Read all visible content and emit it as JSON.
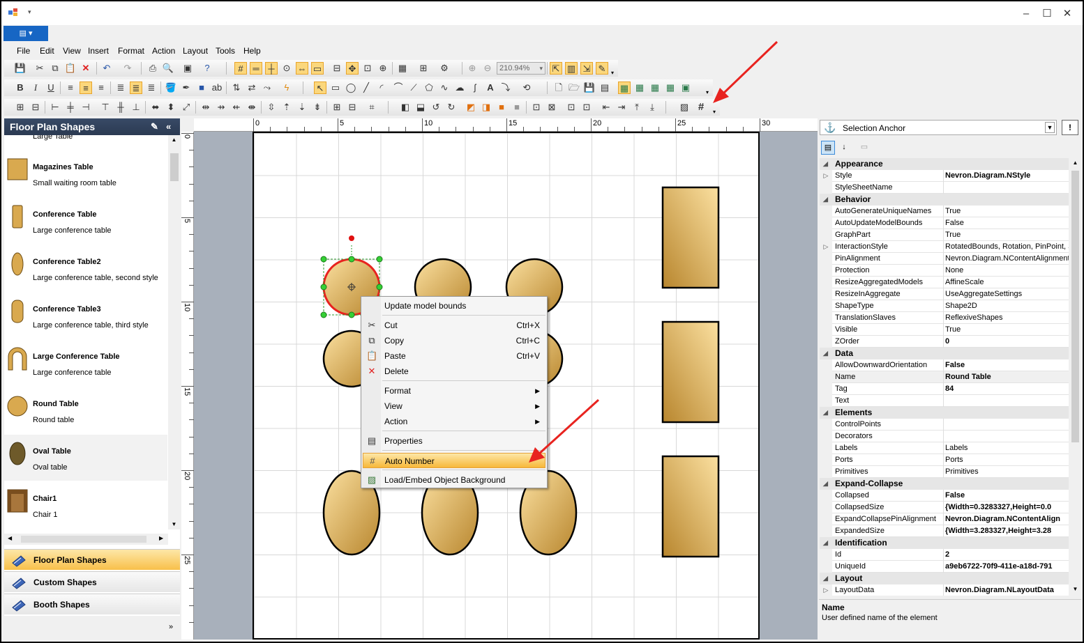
{
  "window": {
    "minimize": "–",
    "maximize": "☐",
    "close": "✕"
  },
  "menu": [
    "File",
    "Edit",
    "View",
    "Insert",
    "Format",
    "Action",
    "Layout",
    "Tools",
    "Help"
  ],
  "toolbar": {
    "zoom": "210.94%"
  },
  "left_panel": {
    "title": "Floor Plan Shapes",
    "partial_item": "Large Table",
    "shapes": [
      {
        "name": "Magazines Table",
        "desc": "Small waiting room table",
        "icon": "square"
      },
      {
        "name": "Conference Table",
        "desc": "Large conference table",
        "icon": "tallrect"
      },
      {
        "name": "Conference Table2",
        "desc": "Large conference table, second style",
        "icon": "tallellipse"
      },
      {
        "name": "Conference Table3",
        "desc": "Large conference table, third style",
        "icon": "capsule"
      },
      {
        "name": "Large Conference Table",
        "desc": "Large conference table",
        "icon": "arch"
      },
      {
        "name": "Round Table",
        "desc": "Round table",
        "icon": "circle"
      },
      {
        "name": "Oval Table",
        "desc": "Oval table",
        "icon": "oval"
      },
      {
        "name": "Chair1",
        "desc": "Chair 1",
        "icon": "chair"
      }
    ],
    "categories": [
      "Floor Plan Shapes",
      "Custom Shapes",
      "Booth Shapes"
    ]
  },
  "ruler": {
    "h": [
      "0",
      "5",
      "10",
      "15",
      "20",
      "25",
      "30"
    ],
    "v": [
      "0",
      "5",
      "10",
      "15",
      "20",
      "25"
    ]
  },
  "context_menu": {
    "items": [
      {
        "label": "Update model bounds",
        "shortcut": "",
        "icon": ""
      },
      {
        "label": "Cut",
        "shortcut": "Ctrl+X",
        "icon": "✂"
      },
      {
        "label": "Copy",
        "shortcut": "Ctrl+C",
        "icon": "⧉"
      },
      {
        "label": "Paste",
        "shortcut": "Ctrl+V",
        "icon": "📋"
      },
      {
        "label": "Delete",
        "shortcut": "",
        "icon": "✕"
      },
      {
        "label": "Format",
        "shortcut": "▶",
        "icon": ""
      },
      {
        "label": "View",
        "shortcut": "▶",
        "icon": ""
      },
      {
        "label": "Action",
        "shortcut": "▶",
        "icon": ""
      },
      {
        "label": "Properties",
        "shortcut": "",
        "icon": "▤"
      },
      {
        "label": "Auto Number",
        "shortcut": "",
        "icon": "#"
      },
      {
        "label": "Load/Embed Object Background",
        "shortcut": "",
        "icon": "▨"
      }
    ]
  },
  "property_grid": {
    "selector": "Selection Anchor",
    "rows": [
      {
        "cat": "Appearance"
      },
      {
        "n": "Style",
        "v": "Nevron.Diagram.NStyle",
        "b": true,
        "exp": true
      },
      {
        "n": "StyleSheetName",
        "v": ""
      },
      {
        "cat": "Behavior"
      },
      {
        "n": "AutoGenerateUniqueNames",
        "v": "True"
      },
      {
        "n": "AutoUpdateModelBounds",
        "v": "False"
      },
      {
        "n": "GraphPart",
        "v": "True"
      },
      {
        "n": "InteractionStyle",
        "v": "RotatedBounds, Rotation, PinPoint, S",
        "exp": true
      },
      {
        "n": "PinAlignment",
        "v": "Nevron.Diagram.NContentAlignment"
      },
      {
        "n": "Protection",
        "v": "None"
      },
      {
        "n": "ResizeAggregatedModels",
        "v": "AffineScale"
      },
      {
        "n": "ResizeInAggregate",
        "v": "UseAggregateSettings"
      },
      {
        "n": "ShapeType",
        "v": "Shape2D"
      },
      {
        "n": "TranslationSlaves",
        "v": "ReflexiveShapes"
      },
      {
        "n": "Visible",
        "v": "True"
      },
      {
        "n": "ZOrder",
        "v": "0",
        "b": true
      },
      {
        "cat": "Data"
      },
      {
        "n": "AllowDownwardOrientation",
        "v": "False",
        "b": true
      },
      {
        "n": "Name",
        "v": "Round Table",
        "b": true,
        "sel": true
      },
      {
        "n": "Tag",
        "v": "84",
        "b": true
      },
      {
        "n": "Text",
        "v": ""
      },
      {
        "cat": "Elements"
      },
      {
        "n": "ControlPoints",
        "v": ""
      },
      {
        "n": "Decorators",
        "v": ""
      },
      {
        "n": "Labels",
        "v": "Labels"
      },
      {
        "n": "Ports",
        "v": "Ports"
      },
      {
        "n": "Primitives",
        "v": "Primitives"
      },
      {
        "cat": "Expand-Collapse"
      },
      {
        "n": "Collapsed",
        "v": "False",
        "b": true
      },
      {
        "n": "CollapsedSize",
        "v": "{Width=0.3283327,Height=0.0",
        "b": true
      },
      {
        "n": "ExpandCollapsePinAlignment",
        "v": "Nevron.Diagram.NContentAlign",
        "b": true
      },
      {
        "n": "ExpandedSize",
        "v": "{Width=3.283327,Height=3.28",
        "b": true
      },
      {
        "cat": "Identification"
      },
      {
        "n": "Id",
        "v": "2",
        "b": true
      },
      {
        "n": "UniqueId",
        "v": "a9eb6722-70f9-411e-a18d-791",
        "b": true
      },
      {
        "cat": "Layout"
      },
      {
        "n": "LayoutData",
        "v": "Nevron.Diagram.NLayoutData",
        "b": true,
        "exp": true
      }
    ],
    "desc_title": "Name",
    "desc_text": "User defined name of the element"
  }
}
